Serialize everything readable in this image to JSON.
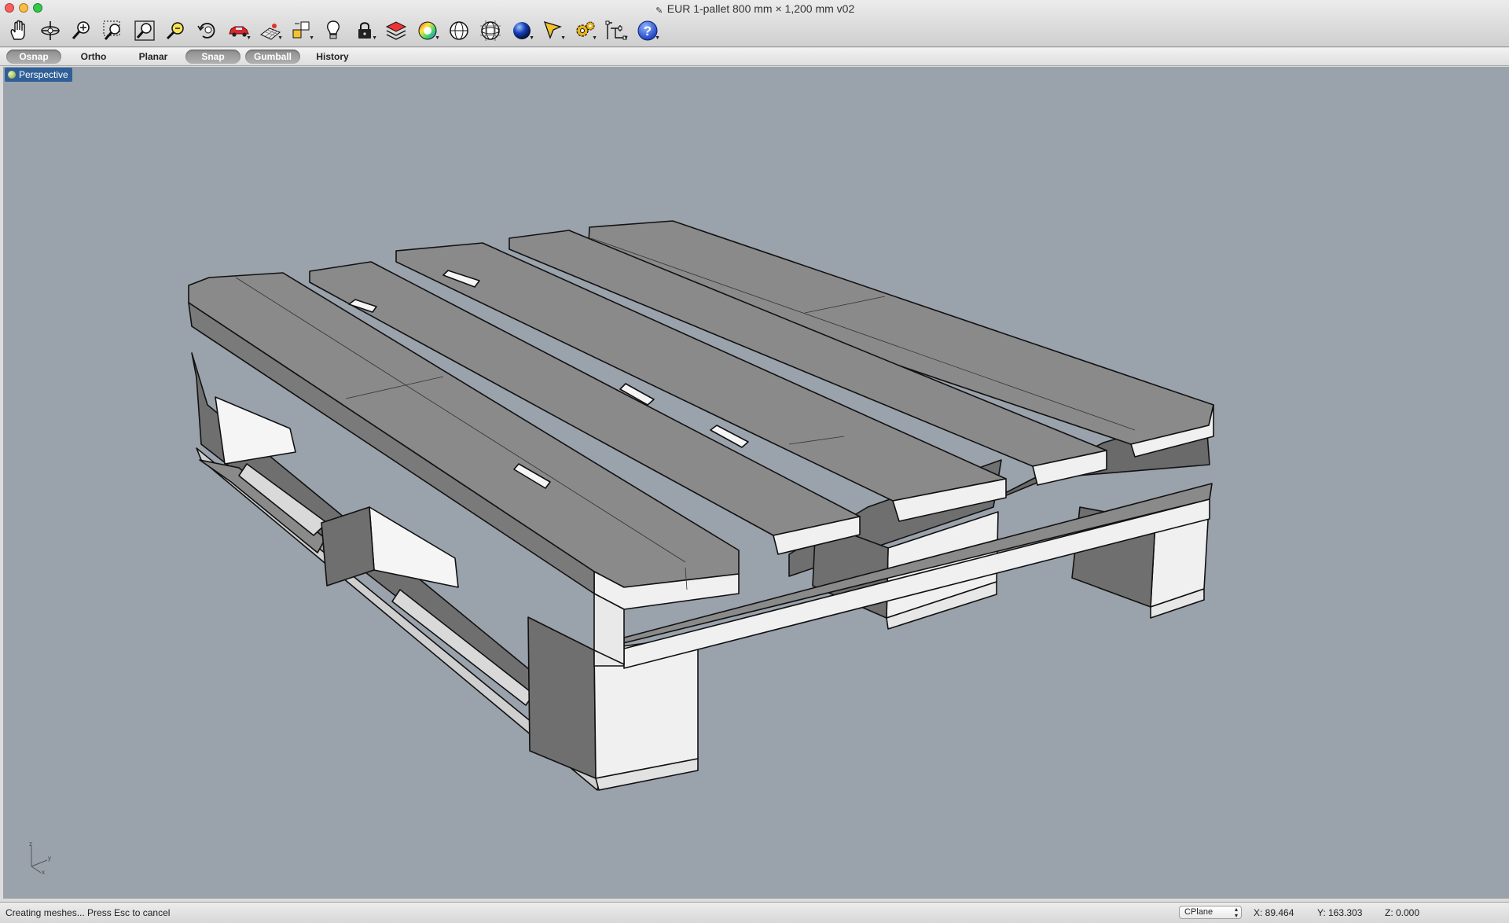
{
  "window": {
    "title": "EUR 1-pallet 800 mm × 1,200 mm v02"
  },
  "toolbar": {
    "icons": [
      "pan-hand-icon",
      "rotate-view-icon",
      "zoom-icon",
      "zoom-window-icon",
      "zoom-extents-icon",
      "zoom-selected-icon",
      "undo-view-icon",
      "car-display-icon",
      "cplane-icon",
      "object-snap-tools-icon",
      "light-bulb-icon",
      "lock-icon",
      "layer-icon",
      "color-wheel-icon",
      "wireframe-sphere-icon",
      "grid-sphere-icon",
      "shaded-sphere-icon",
      "select-arrow-icon",
      "gear-icon",
      "transform-icon",
      "help-icon"
    ]
  },
  "modes": [
    {
      "label": "Osnap",
      "active": true
    },
    {
      "label": "Ortho",
      "active": false
    },
    {
      "label": "Planar",
      "active": false
    },
    {
      "label": "Snap",
      "active": true
    },
    {
      "label": "Gumball",
      "active": true
    },
    {
      "label": "History",
      "active": false
    }
  ],
  "viewport": {
    "name": "Perspective",
    "background": "#9aa2ab",
    "axes": {
      "z": "z",
      "y": "y",
      "x": "x"
    }
  },
  "statusbar": {
    "message": "Creating meshes... Press Esc to cancel",
    "cplane": "CPlane",
    "x": "X: 89.464",
    "y": "Y: 163.303",
    "z": "Z: 0.000"
  },
  "colors": {
    "board_top": "#8a8a8a",
    "board_edge": "#f0f0f0",
    "block_shadow": "#6f6f6f",
    "accent": "#2f5f96"
  }
}
